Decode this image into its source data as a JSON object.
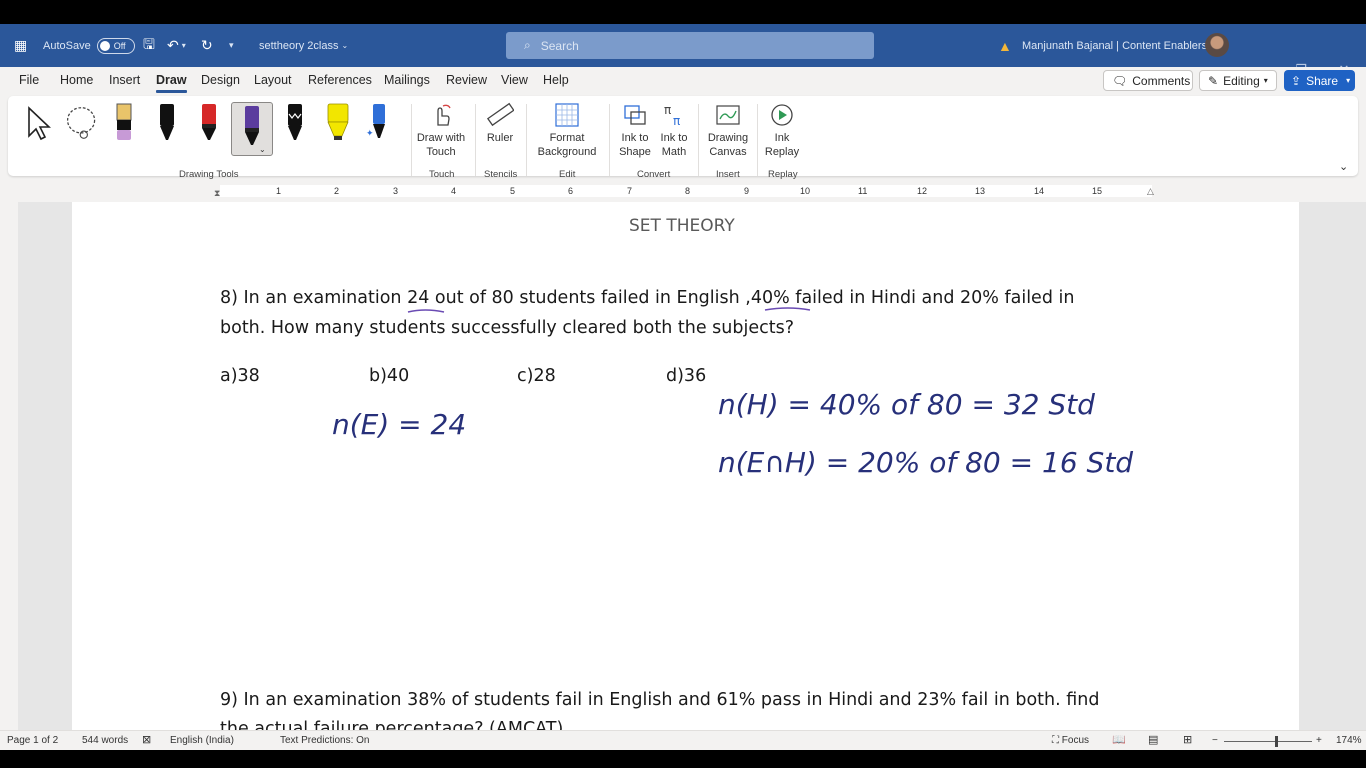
{
  "titlebar": {
    "autosave_label": "AutoSave",
    "autosave_state": "Off",
    "document_name": "settheory 2class",
    "search_placeholder": "Search",
    "user_name": "Manjunath Bajanal | Content Enablers"
  },
  "menu": {
    "tabs": [
      "File",
      "Home",
      "Insert",
      "Draw",
      "Design",
      "Layout",
      "References",
      "Mailings",
      "Review",
      "View",
      "Help"
    ],
    "active_tab": "Draw",
    "comments_label": "Comments",
    "editing_label": "Editing",
    "share_label": "Share"
  },
  "ribbon": {
    "drawing_tools_label": "Drawing Tools",
    "draw_with_touch": "Draw with Touch",
    "touch_group": "Touch",
    "ruler": "Ruler",
    "stencils_group": "Stencils",
    "format_background": "Format Background",
    "edit_group": "Edit",
    "ink_to_shape": "Ink to Shape",
    "ink_to_math": "Ink to Math",
    "convert_group": "Convert",
    "drawing_canvas": "Drawing Canvas",
    "insert_group": "Insert",
    "ink_replay": "Ink Replay",
    "replay_group": "Replay",
    "pen_colors": [
      "#e9c46a",
      "#111111",
      "#d62828",
      "#5b3c9e",
      "#111111",
      "#f2e600",
      "#2f6fd8"
    ]
  },
  "ruler_numbers": [
    "1",
    "2",
    "3",
    "4",
    "5",
    "6",
    "7",
    "8",
    "9",
    "10",
    "11",
    "12",
    "13",
    "14",
    "15"
  ],
  "document": {
    "heading": "SET THEORY",
    "q8_line1": "8) In an examination 24 out of 80 students failed in English ,40% failed in Hindi and 20% failed in",
    "q8_line2": "both. How many students successfully cleared both the subjects?",
    "options": [
      "a)38",
      "b)40",
      "c)28",
      "d)36"
    ],
    "ink_e": "n(E) = 24",
    "ink_h": "n(H) = 40% of 80 = 32 Std",
    "ink_eh": "n(E∩H) = 20% of 80 = 16 Std",
    "q9_line1": "9) In an examination 38% of students fail in English and 61% pass in Hindi and 23% fail in both. find",
    "q9_line2": "the actual failure percentage? (AMCAT)"
  },
  "status": {
    "page": "Page 1 of 2",
    "words": "544 words",
    "language": "English (India)",
    "predictions": "Text Predictions: On",
    "focus": "Focus",
    "zoom": "174%"
  }
}
